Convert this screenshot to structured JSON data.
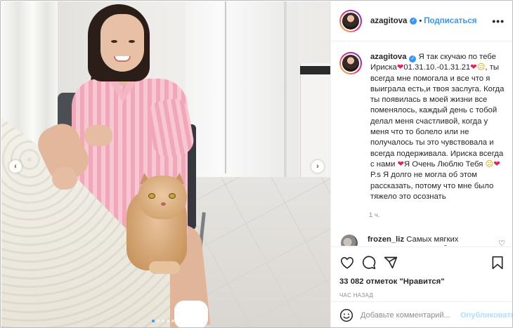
{
  "post": {
    "username": "azagitova",
    "verified_badge": "✓",
    "separator": "•",
    "follow_label": "Подписаться",
    "more_label": "•••"
  },
  "caption": {
    "username": "azagitova",
    "part1": "Я так скучаю по тебе Ириска",
    "part2": "01.31.10.-01.31.21",
    "part3": ", ты всегда мне помогала и все что я выиграла есть,и твоя заслуга. Когда ты появилась в моей жизни все поменялось, каждый день с тобой делал меня счастливой, когда у меня что то болело или не получалось ты это чувствовала и всегда подерживала. Ириска всегда с нами",
    "part4": "Я Очень Люблю Тебя",
    "part5": "P.s Я долго не могла об этом рассказать, потому что мне было тяжело это осознать",
    "time": "1 ч."
  },
  "comment": {
    "username": "frozen_liz",
    "text": "Самых мягких облачков Ириске",
    "emoji": "☁🌈"
  },
  "actions": {
    "likes": "33 082 отметок \"Нравится\"",
    "time_ago": "ЧАС НАЗАД"
  },
  "add_comment": {
    "placeholder": "Добавьте комментарий...",
    "post_label": "Опубликовать"
  },
  "carousel": {
    "prev_label": "‹",
    "next_label": "›",
    "dot_count": 5,
    "active_index": 0
  },
  "icons": [
    "heart-outline-icon",
    "comment-icon",
    "share-icon",
    "bookmark-icon",
    "smiley-icon",
    "like-comment-icon",
    "more-options-icon"
  ],
  "colors": {
    "link": "#3897f0",
    "muted": "#8e8e8e",
    "heart": "#e0245e",
    "post_disabled": "#b2dffc"
  }
}
